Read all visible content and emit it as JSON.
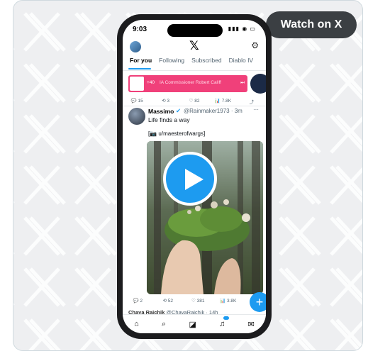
{
  "watch_button": {
    "label": "Watch on X"
  },
  "status_bar": {
    "time": "9:03",
    "icons": "▮▮▮ ◉ ▭"
  },
  "header": {
    "logo": "𝕏"
  },
  "tabs": [
    {
      "label": "For you",
      "active": true
    },
    {
      "label": "Following",
      "active": false
    },
    {
      "label": "Subscribed",
      "active": false
    },
    {
      "label": "Diablo IV",
      "active": false
    }
  ],
  "promo": {
    "count": "+40",
    "text": "IA Commissioner Robert Califf",
    "icon": "⏭"
  },
  "top_actions": {
    "replies": "15",
    "reposts": "3",
    "likes": "82",
    "views": "7.8K"
  },
  "tweet": {
    "name": "Massimo",
    "verified": "✔",
    "handle": "@Rainmaker1973 · 3m",
    "more": "···",
    "text": "Life finds a way",
    "sub": "[📷 u/maesterofwargs]"
  },
  "tweet_actions": {
    "replies": "2",
    "reposts": "52",
    "likes": "381",
    "views": "3.8K"
  },
  "next_tweet": {
    "name": "Chaya Raichik",
    "handle": "@ChayaRaichik · 14h"
  },
  "colors": {
    "accent": "#1d9bf0",
    "promo": "#f0407a",
    "pill": "#3b3f43"
  },
  "icons": {
    "home": "⌂",
    "search": "⌕",
    "compose": "◪",
    "notifications": "♫",
    "messages": "✉",
    "reply": "💬",
    "repost": "⟲",
    "like": "♡",
    "views": "📊",
    "share": "⤴",
    "fab": "+",
    "settings": "⚙"
  }
}
